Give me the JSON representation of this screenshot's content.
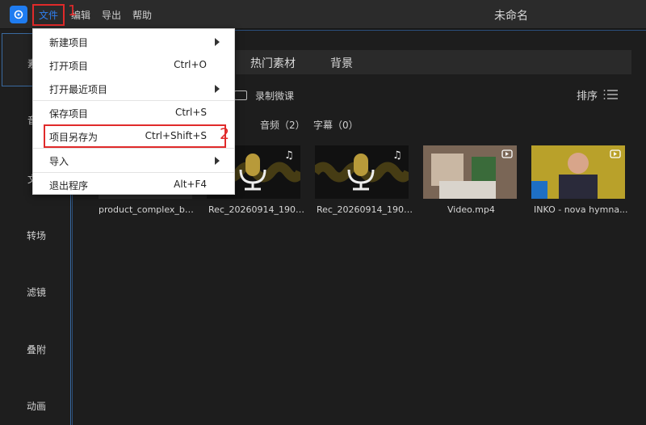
{
  "app": {
    "window_title": "未命名",
    "menubar": [
      "文件",
      "编辑",
      "导出",
      "帮助"
    ]
  },
  "annotations": {
    "step1": "1",
    "step2": "2"
  },
  "sidebar": {
    "items": [
      {
        "label": "素"
      },
      {
        "label": "音"
      },
      {
        "label": "文"
      },
      {
        "label": "转场"
      },
      {
        "label": "滤镜"
      },
      {
        "label": "叠附"
      },
      {
        "label": "动画"
      }
    ]
  },
  "main": {
    "tabs": [
      "热门素材",
      "背景"
    ],
    "record_label": "录制微课",
    "sort_label": "排序",
    "filters": [
      "）",
      "音频（2）",
      "字幕（0）"
    ],
    "media": [
      {
        "name": "product_complex_bg...",
        "kind": "image"
      },
      {
        "name": "Rec_20260914_1909...",
        "kind": "audio"
      },
      {
        "name": "Rec_20260914_1909...",
        "kind": "audio"
      },
      {
        "name": "Video.mp4",
        "kind": "video"
      },
      {
        "name": "INKO - nova hymna...",
        "kind": "video"
      }
    ]
  },
  "file_menu": {
    "items": [
      {
        "label": "新建项目",
        "shortcut": "",
        "submenu": true
      },
      {
        "label": "打开项目",
        "shortcut": "Ctrl+O",
        "submenu": false
      },
      {
        "label": "打开最近项目",
        "shortcut": "",
        "submenu": true
      },
      {
        "label": "保存项目",
        "shortcut": "Ctrl+S",
        "submenu": false
      },
      {
        "label": "项目另存为",
        "shortcut": "Ctrl+Shift+S",
        "submenu": false
      },
      {
        "label": "导入",
        "shortcut": "",
        "submenu": true
      },
      {
        "label": "退出程序",
        "shortcut": "Alt+F4",
        "submenu": false
      }
    ]
  },
  "colors": {
    "accent": "#2f7ff0",
    "highlight": "#e02a2a",
    "waveform": "#c9a227"
  }
}
